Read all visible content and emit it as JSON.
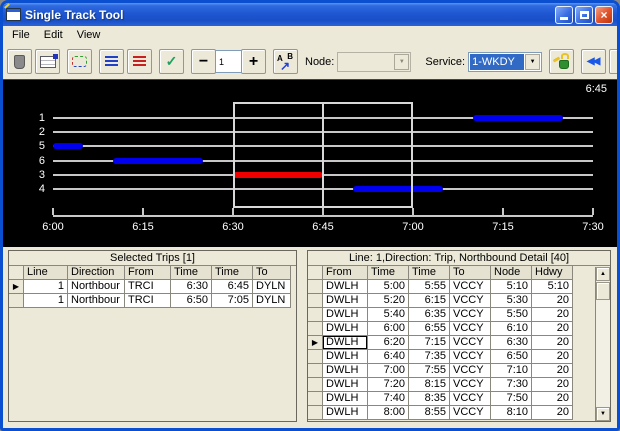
{
  "window": {
    "title": "Single Track Tool"
  },
  "menu": {
    "items": [
      "File",
      "Edit",
      "View"
    ]
  },
  "toolbar": {
    "counter_value": "1",
    "node_label": "Node:",
    "node_value": "",
    "service_label": "Service:",
    "service_value": "1-WKDY",
    "ab_a": "A",
    "ab_b": "B"
  },
  "icons": {
    "close": "×",
    "check": "✓",
    "minus": "−",
    "plus": "+",
    "ab_arrow": "↗",
    "nav_first": "◀◀",
    "nav_prev": "◀",
    "nav_next": "▶",
    "nav_last": "▶▶",
    "marker": "▶",
    "scroll_up": "▲",
    "scroll_down": "▼",
    "dropdown_arrow": "▼"
  },
  "colors": {
    "segment_blue": "#0000ee",
    "segment_red": "#ee0000",
    "track_line": "#c8c8c8",
    "selection_box": "#d8d8d8",
    "highlight": "#316ac5",
    "chart_bg": "#000000"
  },
  "chart_data": {
    "type": "track-occupancy-timeline",
    "cursor_time_label": "6:45",
    "time_axis": {
      "start": "6:00",
      "end": "7:30",
      "interval_min": 15,
      "tick_labels": [
        "6:00",
        "6:15",
        "6:30",
        "6:45",
        "7:00",
        "7:15",
        "7:30"
      ]
    },
    "tracks": [
      {
        "label": "1",
        "segments": [
          {
            "start": "7:10",
            "end": "7:25",
            "color": "blue"
          }
        ]
      },
      {
        "label": "2",
        "segments": []
      },
      {
        "label": "5",
        "segments": [
          {
            "start": "6:00",
            "end": "6:05",
            "color": "blue"
          }
        ]
      },
      {
        "label": "6",
        "segments": [
          {
            "start": "6:10",
            "end": "6:25",
            "color": "blue"
          }
        ]
      },
      {
        "label": "3",
        "segments": [
          {
            "start": "6:30",
            "end": "6:45",
            "color": "red"
          }
        ]
      },
      {
        "label": "4",
        "segments": [
          {
            "start": "6:50",
            "end": "7:05",
            "color": "blue"
          }
        ]
      }
    ],
    "selection_box": {
      "start": "6:30",
      "end": "7:00",
      "divider": "6:45"
    }
  },
  "selected_trips": {
    "title": "Selected Trips [1]",
    "columns": [
      "Line",
      "Direction",
      "From",
      "Time",
      "Time",
      "To"
    ],
    "align": [
      "right",
      "left",
      "left",
      "right",
      "right",
      "left"
    ],
    "marker_row": 0,
    "rows": [
      [
        "1",
        "Northbour",
        "TRCI",
        "6:30",
        "6:45",
        "DYLN"
      ],
      [
        "1",
        "Northbour",
        "TRCI",
        "6:50",
        "7:05",
        "DYLN"
      ]
    ]
  },
  "detail_table": {
    "title": "Line: 1,Direction: Trip, Northbound Detail [40]",
    "columns": [
      "From",
      "Time",
      "Time",
      "To",
      "Node",
      "Hdwy"
    ],
    "align": [
      "left",
      "right",
      "right",
      "left",
      "right",
      "right"
    ],
    "marker_row": 4,
    "focus_cell": {
      "row": 4,
      "col": 0
    },
    "rows": [
      [
        "DWLH",
        "5:00",
        "5:55",
        "VCCY",
        "5:10",
        "5:10"
      ],
      [
        "DWLH",
        "5:20",
        "6:15",
        "VCCY",
        "5:30",
        "20"
      ],
      [
        "DWLH",
        "5:40",
        "6:35",
        "VCCY",
        "5:50",
        "20"
      ],
      [
        "DWLH",
        "6:00",
        "6:55",
        "VCCY",
        "6:10",
        "20"
      ],
      [
        "DWLH",
        "6:20",
        "7:15",
        "VCCY",
        "6:30",
        "20"
      ],
      [
        "DWLH",
        "6:40",
        "7:35",
        "VCCY",
        "6:50",
        "20"
      ],
      [
        "DWLH",
        "7:00",
        "7:55",
        "VCCY",
        "7:10",
        "20"
      ],
      [
        "DWLH",
        "7:20",
        "8:15",
        "VCCY",
        "7:30",
        "20"
      ],
      [
        "DWLH",
        "7:40",
        "8:35",
        "VCCY",
        "7:50",
        "20"
      ],
      [
        "DWLH",
        "8:00",
        "8:55",
        "VCCY",
        "8:10",
        "20"
      ]
    ]
  }
}
